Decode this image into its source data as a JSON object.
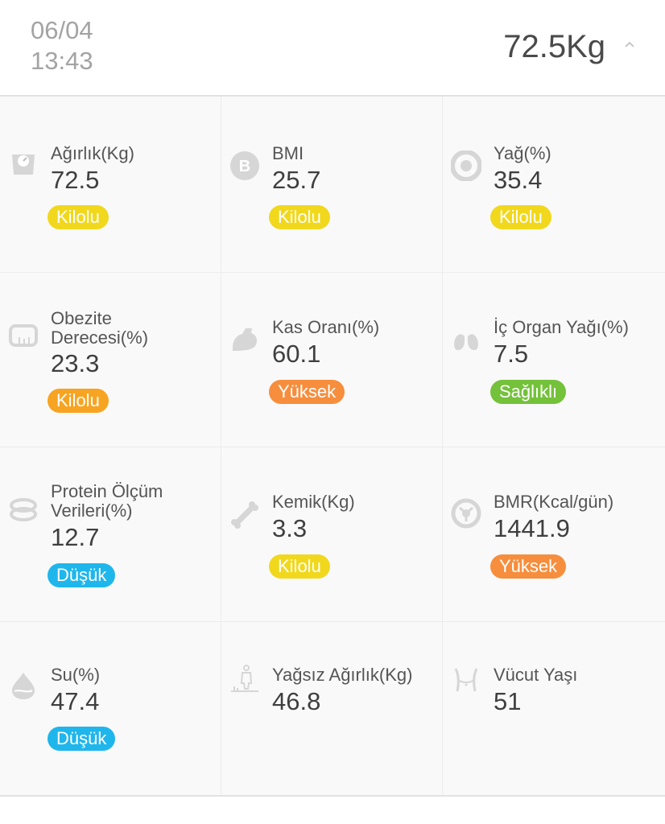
{
  "header": {
    "date": "06/04",
    "time": "13:43",
    "weight": "72.5Kg"
  },
  "metrics": [
    {
      "label": "Ağırlık(Kg)",
      "value": "72.5",
      "status": "Kilolu",
      "icon": "scale-icon",
      "color": "#f1d81d"
    },
    {
      "label": "BMI",
      "value": "25.7",
      "status": "Kilolu",
      "icon": "bmi-icon",
      "color": "#f1d81d"
    },
    {
      "label": "Yağ(%)",
      "value": "35.4",
      "status": "Kilolu",
      "icon": "fat-icon",
      "color": "#f1d81d"
    },
    {
      "label_line1": "Obezite",
      "label_line2": "Derecesi(%)",
      "value": "23.3",
      "status": "Kilolu",
      "icon": "tape-measure-icon",
      "color": "#f7a422"
    },
    {
      "label": "Kas Oranı(%)",
      "value": "60.1",
      "status": "Yüksek",
      "icon": "muscle-icon",
      "color": "#f68e3d"
    },
    {
      "label": "İç Organ Yağı(%)",
      "value": "7.5",
      "status": "Sağlıklı",
      "icon": "lungs-icon",
      "color": "#74c13a"
    },
    {
      "label_line1": "Protein Ölçüm",
      "label_line2": "Verileri(%)",
      "value": "12.7",
      "status": "Düşük",
      "icon": "protein-icon",
      "color": "#1fb6ec"
    },
    {
      "label": "Kemik(Kg)",
      "value": "3.3",
      "status": "Kilolu",
      "icon": "bone-icon",
      "color": "#f1d81d"
    },
    {
      "label": "BMR(Kcal/gün)",
      "value": "1441.9",
      "status": "Yüksek",
      "icon": "bmr-icon",
      "color": "#f68e3d"
    },
    {
      "label": "Su(%)",
      "value": "47.4",
      "status": "Düşük",
      "icon": "water-drop-icon",
      "color": "#1fb6ec"
    },
    {
      "label": "Yağsız Ağırlık(Kg)",
      "value": "46.8",
      "icon": "lean-body-icon"
    },
    {
      "label": "Vücut Yaşı",
      "value": "51",
      "icon": "body-age-icon"
    }
  ]
}
